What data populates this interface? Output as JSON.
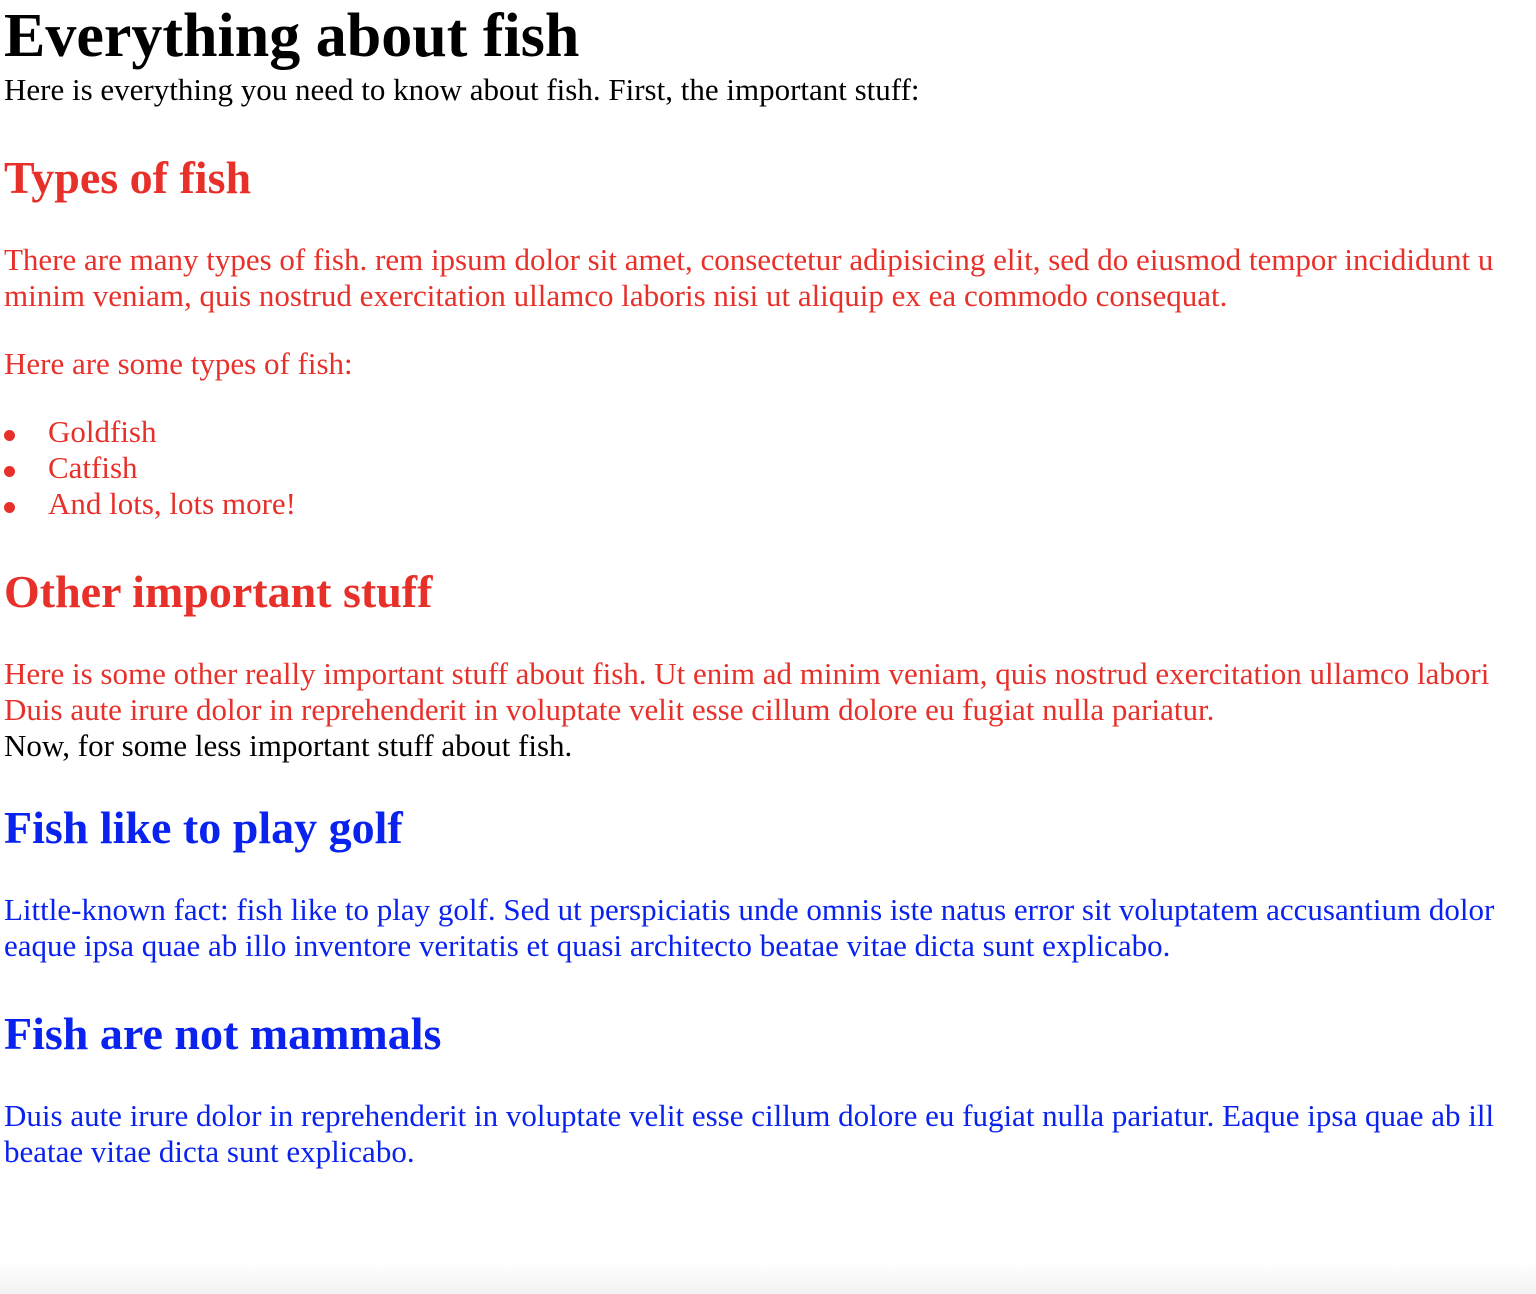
{
  "colors": {
    "important": "#e8302a",
    "less_important": "#0a22ee",
    "default_text": "#000000"
  },
  "page": {
    "title": "Everything about fish",
    "intro": "Here is everything you need to know about fish. First, the important stuff:",
    "types_section": {
      "heading": "Types of fish",
      "paragraph_line1": "There are many types of fish. rem ipsum dolor sit amet, consectetur adipisicing elit, sed do eiusmod tempor incididunt u",
      "paragraph_line2": "minim veniam, quis nostrud exercitation ullamco laboris nisi ut aliquip ex ea commodo consequat.",
      "lead": "Here are some types of fish:",
      "items": [
        "Goldfish",
        "Catfish",
        "And lots, lots more!"
      ]
    },
    "other_section": {
      "heading": "Other important stuff",
      "paragraph_line1": "Here is some other really important stuff about fish. Ut enim ad minim veniam, quis nostrud exercitation ullamco labori",
      "paragraph_line2": "Duis aute irure dolor in reprehenderit in voluptate velit esse cillum dolore eu fugiat nulla pariatur."
    },
    "outro": "Now, for some less important stuff about fish.",
    "golf_section": {
      "heading": "Fish like to play golf",
      "paragraph_line1": "Little-known fact: fish like to play golf. Sed ut perspiciatis unde omnis iste natus error sit voluptatem accusantium dolor",
      "paragraph_line2": "eaque ipsa quae ab illo inventore veritatis et quasi architecto beatae vitae dicta sunt explicabo."
    },
    "mammals_section": {
      "heading": "Fish are not mammals",
      "paragraph_line1": "Duis aute irure dolor in reprehenderit in voluptate velit esse cillum dolore eu fugiat nulla pariatur. Eaque ipsa quae ab ill",
      "paragraph_line2": "beatae vitae dicta sunt explicabo."
    }
  }
}
